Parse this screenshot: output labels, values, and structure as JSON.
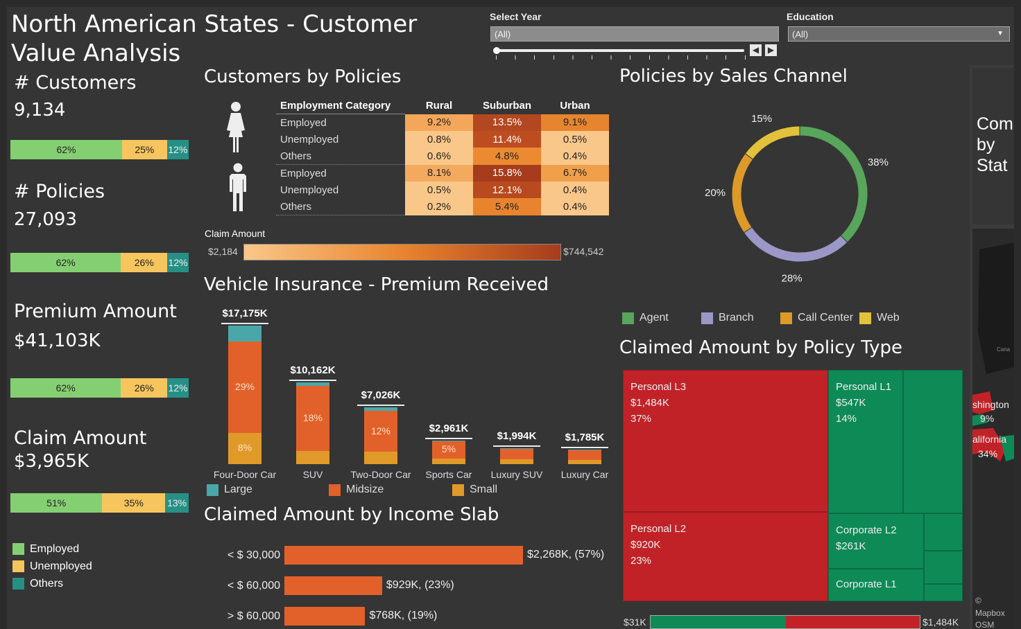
{
  "header": {
    "title": "North American States - Customer Value Analysis"
  },
  "filters": {
    "year_label": "Select Year",
    "year_value": "(All)",
    "education_label": "Education",
    "education_value": "(All)"
  },
  "kpis": [
    {
      "label": "# Customers",
      "value": "9,134",
      "employed": "62%",
      "unemployed": "25%",
      "others": "12%",
      "shares": [
        0.62,
        0.25,
        0.12
      ]
    },
    {
      "label": "# Policies",
      "value": "27,093",
      "employed": "62%",
      "unemployed": "26%",
      "others": "12%",
      "shares": [
        0.62,
        0.26,
        0.12
      ]
    },
    {
      "label": "Premium Amount",
      "value": "$41,103K",
      "employed": "62%",
      "unemployed": "26%",
      "others": "12%",
      "shares": [
        0.62,
        0.26,
        0.12
      ]
    },
    {
      "label": "Claim Amount",
      "value": "$3,965K",
      "employed": "51%",
      "unemployed": "35%",
      "others": "13%",
      "shares": [
        0.51,
        0.35,
        0.13
      ]
    }
  ],
  "kpi_legend": {
    "employed": "Employed",
    "unemployed": "Unemployed",
    "others": "Others",
    "colors": {
      "employed": "#85cf73",
      "unemployed": "#f7c55e",
      "others": "#279086"
    }
  },
  "customers_by_policies": {
    "title": "Customers by Policies",
    "col_header": "Employment Category",
    "columns": [
      "Rural",
      "Suburban",
      "Urban"
    ],
    "female_icon": "female-person-icon",
    "male_icon": "male-person-icon",
    "female_rows": [
      {
        "label": "Employed",
        "values": [
          "9.2%",
          "13.5%",
          "9.1%"
        ],
        "colors": [
          "#f4a75a",
          "#b3471f",
          "#e7842e"
        ]
      },
      {
        "label": "Unemployed",
        "values": [
          "0.8%",
          "11.4%",
          "0.5%"
        ],
        "colors": [
          "#f9c78a",
          "#bd4d20",
          "#f9c78a"
        ]
      },
      {
        "label": "Others",
        "values": [
          "0.6%",
          "4.8%",
          "0.4%"
        ],
        "colors": [
          "#f9c78a",
          "#ec8a32",
          "#f9c78a"
        ]
      }
    ],
    "male_rows": [
      {
        "label": "Employed",
        "values": [
          "8.1%",
          "15.8%",
          "6.7%"
        ],
        "colors": [
          "#f4aa5e",
          "#a63c1c",
          "#f0a04a"
        ]
      },
      {
        "label": "Unemployed",
        "values": [
          "0.5%",
          "12.1%",
          "0.4%"
        ],
        "colors": [
          "#f9c78a",
          "#b9491f",
          "#f9c78a"
        ]
      },
      {
        "label": "Others",
        "values": [
          "0.2%",
          "5.4%",
          "0.4%"
        ],
        "colors": [
          "#f9c78a",
          "#e9842e",
          "#f9c78a"
        ]
      }
    ],
    "scale_label": "Claim Amount",
    "scale_min": "$2,184",
    "scale_max": "$744,542"
  },
  "vehicle": {
    "title": "Vehicle Insurance - Premium Received",
    "legend": {
      "large": "Large",
      "midsize": "Midsize",
      "small": "Small"
    },
    "colors": {
      "large": "#4aa7a9",
      "midsize": "#e2612a",
      "small": "#e09a2a"
    }
  },
  "chart_data": {
    "type": "bar",
    "categories": [
      "Four-Door Car",
      "SUV",
      "Two-Door Car",
      "Sports Car",
      "Luxury SUV",
      "Luxury Car"
    ],
    "series": [
      {
        "name": "Large",
        "values": [
          2000,
          500,
          400,
          100,
          70,
          60
        ]
      },
      {
        "name": "Midsize",
        "values": [
          11300,
          8000,
          5100,
          2200,
          1350,
          1250
        ]
      },
      {
        "name": "Small",
        "values": [
          3875,
          1662,
          1526,
          661,
          574,
          475
        ]
      }
    ],
    "totals": [
      17175,
      10162,
      7026,
      2961,
      1994,
      1785
    ],
    "total_labels": [
      "$17,175K",
      "$10,162K",
      "$7,026K",
      "$2,961K",
      "$1,994K",
      "$1,785K"
    ],
    "segment_labels": [
      [
        "29%",
        "8%"
      ],
      [
        "18%"
      ],
      [
        "12%"
      ],
      [
        "5%"
      ],
      [],
      []
    ],
    "ylim": [
      0,
      17175
    ],
    "stacked": true
  },
  "income": {
    "title": "Claimed Amount by Income Slab",
    "rows": [
      {
        "label": "< $ 30,000",
        "value": 2268,
        "text": "$2,268K, (57%)"
      },
      {
        "label": "< $ 60,000",
        "value": 929,
        "text": "$929K, (23%)"
      },
      {
        "label": "> $ 60,000",
        "value": 768,
        "text": "$768K, (19%)"
      }
    ]
  },
  "sales_channel": {
    "title": "Policies by Sales Channel",
    "slices": [
      {
        "name": "Agent",
        "share": 0.38,
        "label": "38%",
        "color": "#58a55c"
      },
      {
        "name": "Branch",
        "share": 0.28,
        "label": "28%",
        "color": "#9b97c7"
      },
      {
        "name": "Call Center",
        "share": 0.2,
        "label": "20%",
        "color": "#dd9a28"
      },
      {
        "name": "Web",
        "share": 0.15,
        "label": "15%",
        "color": "#e2c23a"
      }
    ]
  },
  "policy_type": {
    "title": "Claimed Amount by Policy Type",
    "cells": {
      "l3": {
        "name": "Personal L3",
        "value": "$1,484K",
        "pct": "37%"
      },
      "l1": {
        "name": "Personal L1",
        "value": "$547K",
        "pct": "14%"
      },
      "l2": {
        "name": "Personal L2",
        "value": "$920K",
        "pct": "23%"
      },
      "c2": {
        "name": "Corporate L2",
        "value": "$261K"
      },
      "c1": {
        "name": "Corporate L1"
      }
    },
    "range_min": "$31K",
    "range_max": "$1,484K",
    "colors": {
      "red": "#c12228",
      "green": "#0e8a57"
    }
  },
  "map": {
    "title": "Com by Stat",
    "labels": {
      "wash": "shington",
      "wash_pct": "9%",
      "cal": "alifornia",
      "cal_pct": "34%",
      "cana": "Cana"
    },
    "attribution": {
      "copy": "©",
      "mapbox": "Mapbox",
      "osm": "OSM"
    }
  }
}
